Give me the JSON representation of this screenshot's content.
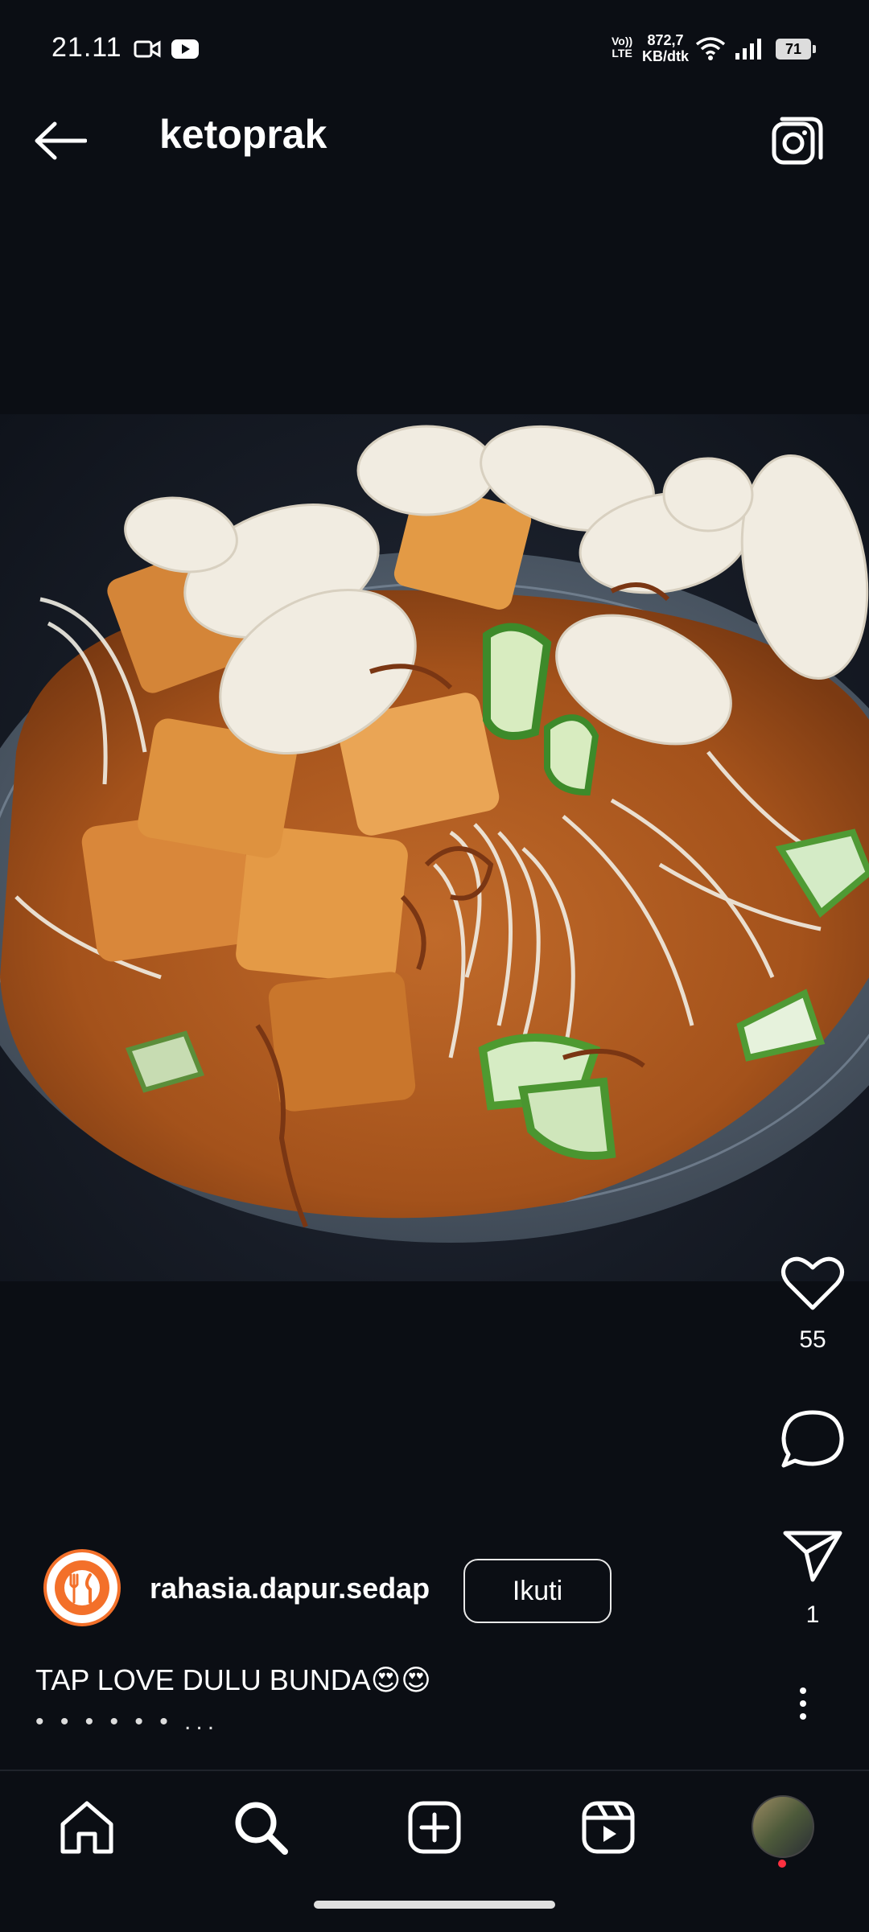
{
  "status_bar": {
    "time": "21.11",
    "volte_top": "Vo))",
    "volte_bottom": "LTE",
    "net_speed_value": "872,7",
    "net_speed_unit": "KB/dtk",
    "battery": "71",
    "icons": [
      "video-camera-icon",
      "youtube-icon",
      "wifi-icon",
      "signal-icon",
      "battery-icon"
    ]
  },
  "header": {
    "title": "ketoprak",
    "back_icon": "arrow-left-icon",
    "camera_icon": "camera-icon"
  },
  "post": {
    "image_alt": "Ketoprak dish with peanut sauce, tofu, crackers, cucumber and bean sprouts",
    "likes": "55",
    "shares": "1",
    "author": "rahasia.dapur.sedap",
    "follow_label": "Ikuti",
    "caption": "TAP LOVE DULU BUNDA😍😍",
    "caption_more": "• • • • • • ..."
  },
  "bottom_nav": {
    "items": [
      "home-icon",
      "search-icon",
      "create-icon",
      "reels-icon",
      "profile-avatar"
    ]
  },
  "colors": {
    "background": "#0b0e14",
    "accent_orange": "#f3702a",
    "notification_red": "#ff3040"
  }
}
